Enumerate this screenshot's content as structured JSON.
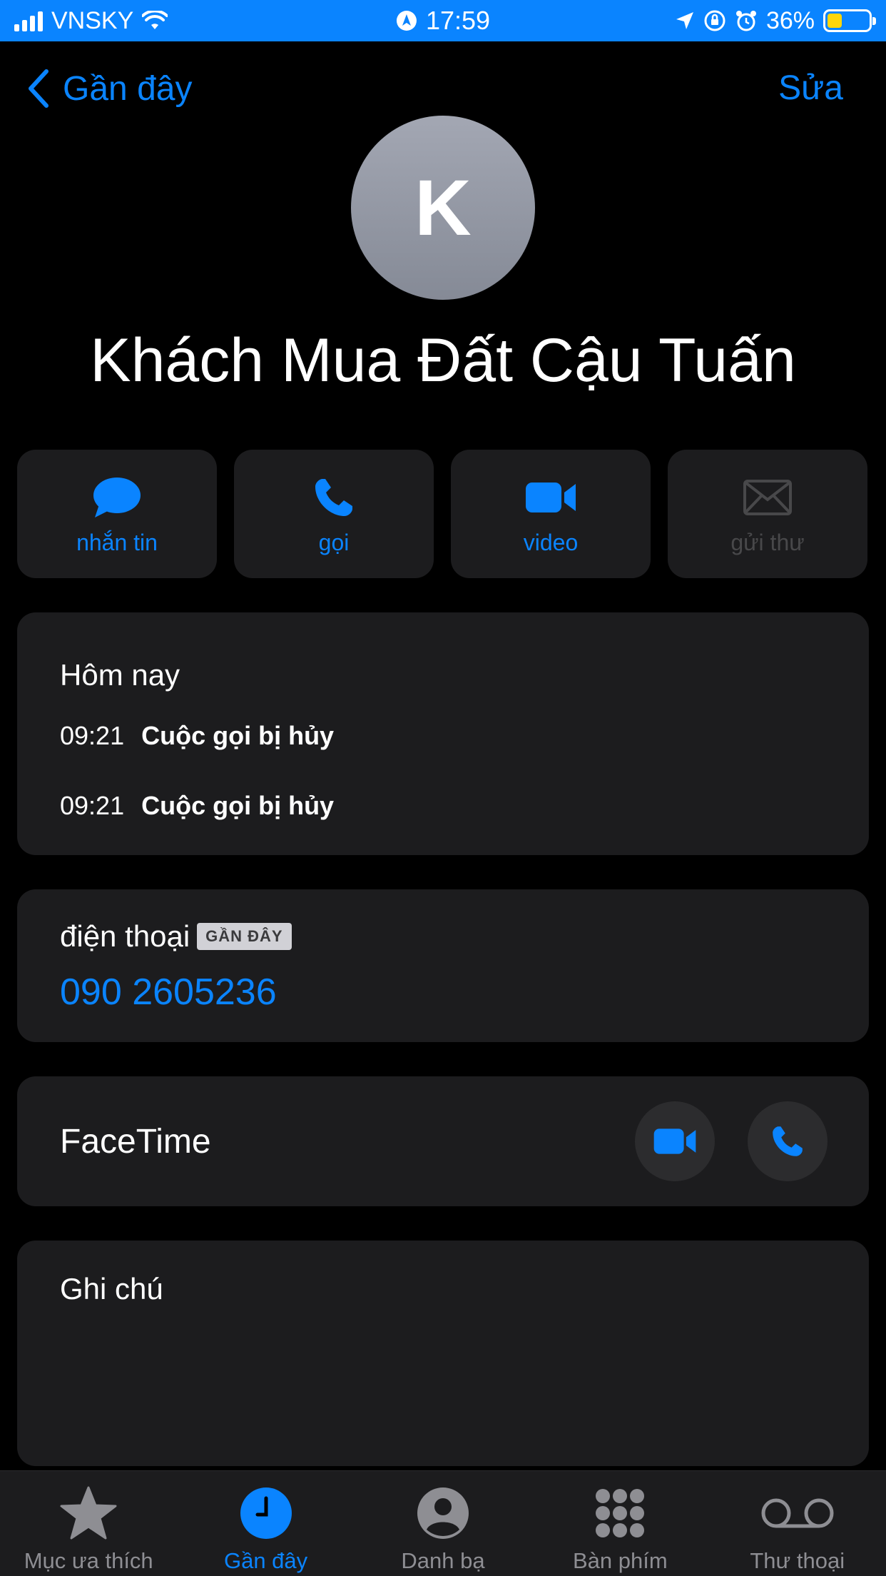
{
  "status_bar": {
    "carrier": "VNSKY",
    "time": "17:59",
    "battery": "36%",
    "battery_level": 0.36
  },
  "nav": {
    "back_label": "Gần đây",
    "edit_label": "Sửa"
  },
  "contact": {
    "initial": "K",
    "name": "Khách Mua Đất Cậu Tuấn"
  },
  "actions": [
    {
      "label": "nhắn tin",
      "icon": "message-bubble-icon",
      "enabled": true
    },
    {
      "label": "gọi",
      "icon": "phone-icon",
      "enabled": true
    },
    {
      "label": "video",
      "icon": "video-camera-icon",
      "enabled": true
    },
    {
      "label": "gửi thư",
      "icon": "envelope-icon",
      "enabled": false
    }
  ],
  "history": {
    "heading": "Hôm nay",
    "entries": [
      {
        "time": "09:21",
        "event": "Cuộc gọi bị hủy"
      },
      {
        "time": "09:21",
        "event": "Cuộc gọi bị hủy"
      }
    ]
  },
  "phone": {
    "label": "điện thoại",
    "badge": "GẦN ĐÂY",
    "number": "090 2605236"
  },
  "facetime": {
    "label": "FaceTime"
  },
  "notes": {
    "label": "Ghi chú"
  },
  "tab_bar": {
    "tabs": [
      {
        "label": "Mục ưa thích",
        "icon": "star-icon",
        "active": false
      },
      {
        "label": "Gần đây",
        "icon": "clock-icon",
        "active": true
      },
      {
        "label": "Danh bạ",
        "icon": "person-circle-icon",
        "active": false
      },
      {
        "label": "Bàn phím",
        "icon": "keypad-icon",
        "active": false
      },
      {
        "label": "Thư thoại",
        "icon": "voicemail-icon",
        "active": false
      }
    ]
  },
  "colors": {
    "accent": "#0a84ff",
    "card": "#1c1c1e",
    "background": "#000000"
  }
}
